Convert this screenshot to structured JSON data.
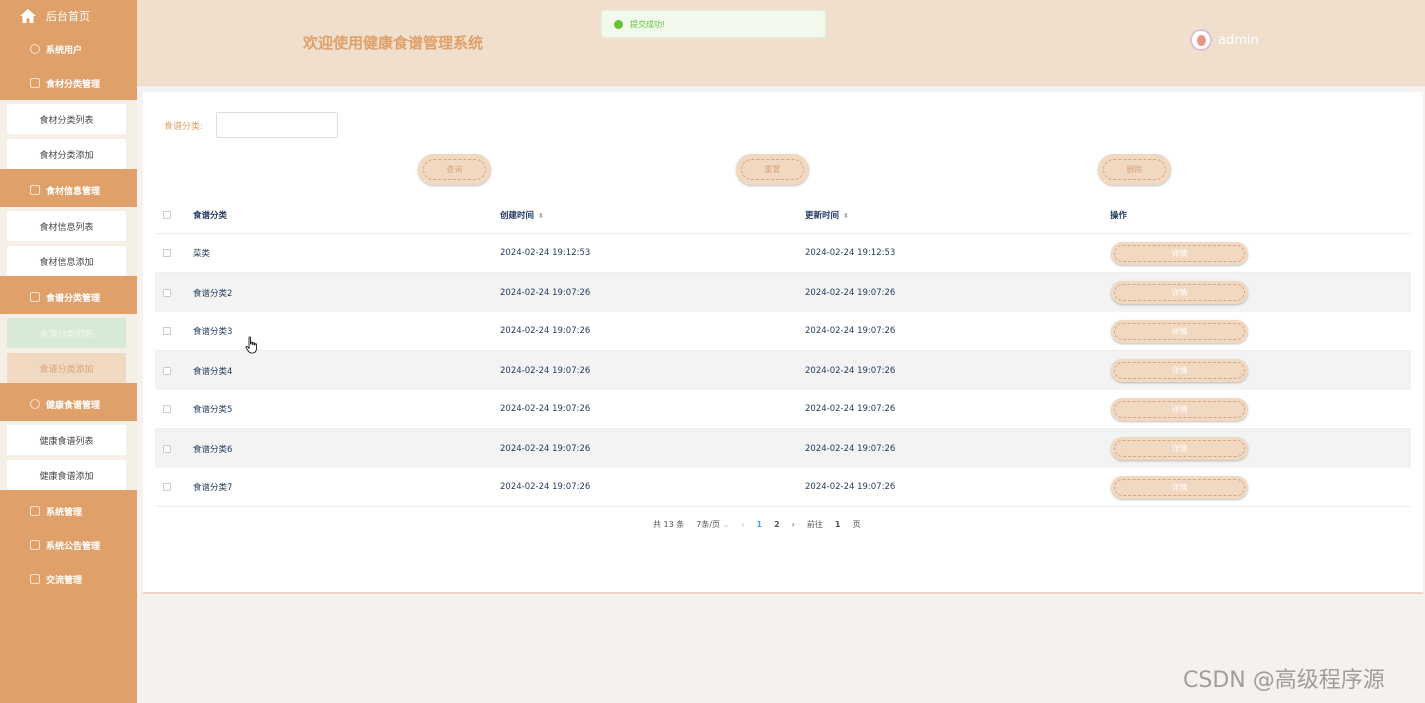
{
  "sidebar": {
    "home": "后台首页",
    "sections": [
      {
        "title": "系统用户",
        "items": []
      },
      {
        "title": "食材分类管理",
        "items": [
          "食材分类列表",
          "食材分类添加"
        ]
      },
      {
        "title": "食材信息管理",
        "items": [
          "食材信息列表",
          "食材信息添加"
        ]
      },
      {
        "title": "食谱分类管理",
        "items": [
          "食谱分类列表",
          "食谱分类添加"
        ]
      },
      {
        "title": "健康食谱管理",
        "items": [
          "健康食谱列表",
          "健康食谱添加"
        ]
      },
      {
        "title": "系统管理",
        "items": []
      },
      {
        "title": "系统公告管理",
        "items": []
      },
      {
        "title": "交流管理",
        "items": []
      }
    ]
  },
  "header": {
    "title": "欢迎使用健康食谱管理系统",
    "toast": "提交成功!",
    "username": "admin"
  },
  "filter": {
    "label": "食谱分类:",
    "value": ""
  },
  "buttons": {
    "query": "查询",
    "reset": "重置",
    "delete": "删除"
  },
  "table": {
    "columns": [
      "食谱分类",
      "创建时间",
      "更新时间",
      "操作"
    ],
    "rows": [
      {
        "name": "菜类",
        "created": "2024-02-24 19:12:53",
        "updated": "2024-02-24 19:12:53"
      },
      {
        "name": "食谱分类2",
        "created": "2024-02-24 19:07:26",
        "updated": "2024-02-24 19:07:26"
      },
      {
        "name": "食谱分类3",
        "created": "2024-02-24 19:07:26",
        "updated": "2024-02-24 19:07:26"
      },
      {
        "name": "食谱分类4",
        "created": "2024-02-24 19:07:26",
        "updated": "2024-02-24 19:07:26"
      },
      {
        "name": "食谱分类5",
        "created": "2024-02-24 19:07:26",
        "updated": "2024-02-24 19:07:26"
      },
      {
        "name": "食谱分类6",
        "created": "2024-02-24 19:07:26",
        "updated": "2024-02-24 19:07:26"
      },
      {
        "name": "食谱分类7",
        "created": "2024-02-24 19:07:26",
        "updated": "2024-02-24 19:07:26"
      }
    ],
    "detail_label": "详情"
  },
  "pagination": {
    "total": "共 13 条",
    "page_size": "7条/页",
    "pages": [
      "1",
      "2"
    ],
    "goto_prefix": "前往",
    "goto_value": "1",
    "goto_suffix": "页"
  },
  "watermark": "CSDN @高级程序源",
  "colors": {
    "sidebar": "#e0a06a",
    "header": "#efdfcc",
    "button": "#f0d8c1",
    "accent": "#e0a06a"
  }
}
